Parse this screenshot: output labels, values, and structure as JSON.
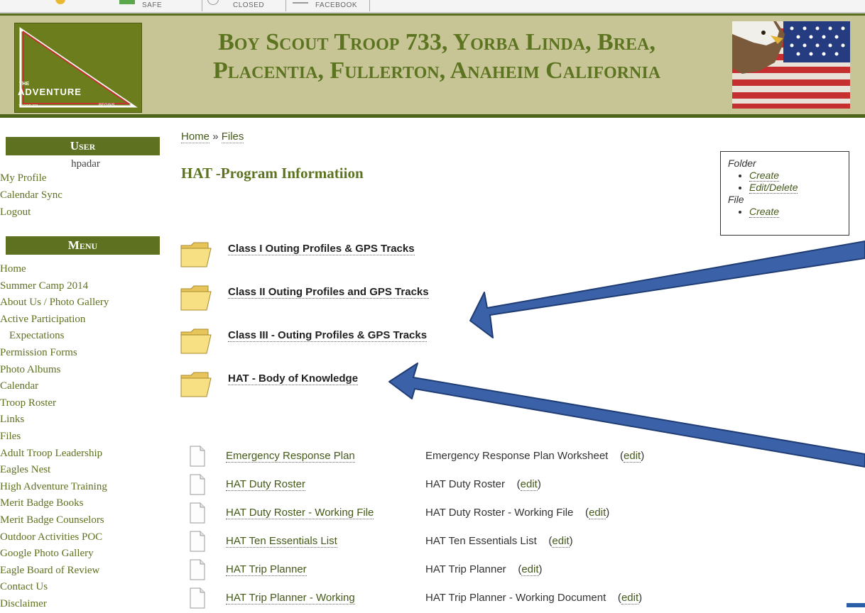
{
  "topbar": {
    "item_safe": "SAFE",
    "item_closed": "CLOSED",
    "item_facebook": "FACEBOOK"
  },
  "header": {
    "title": "Boy Scout Troop 733, Yorba Linda, Brea, Placentia, Fullerton, Anaheim California",
    "logo_the": "THE",
    "logo_adventure": "ADVENTURE",
    "logo_begins": "BEGINS...",
    "logo_troop": "TROOP 733"
  },
  "sidebar": {
    "user_title": "User",
    "username": "hpadar",
    "user_links": [
      "My Profile",
      "Calendar Sync",
      "Logout"
    ],
    "menu_title": "Menu",
    "menu_items": [
      "Home",
      "Summer Camp 2014",
      "About Us / Photo Gallery",
      "Active Participation",
      "Expectations",
      "Permission Forms",
      "Photo Albums",
      "Calendar",
      "Troop Roster",
      "Links",
      "Files",
      "Adult Troop Leadership",
      "Eagles Nest",
      "High Adventure Training",
      "Merit Badge Books",
      "Merit Badge Counselors",
      "Outdoor Activities POC",
      "Google Photo Gallery",
      "Eagle Board of Review",
      "Contact Us",
      "Disclaimer"
    ]
  },
  "breadcrumb": {
    "home": "Home",
    "sep": "»",
    "files": "Files"
  },
  "page_title": "HAT -Program Informatiion",
  "admin_box": {
    "folder_label": "Folder",
    "folder_create": "Create",
    "folder_edit": "Edit/Delete",
    "file_label": "File",
    "file_create": "Create"
  },
  "folders": [
    "Class I Outing Profiles & GPS Tracks",
    "Class II Outing Profiles and GPS Tracks",
    "Class III - Outing Profiles & GPS Tracks",
    "HAT - Body of Knowledge"
  ],
  "files": [
    {
      "name": "Emergency Response Plan",
      "desc": "Emergency Response Plan Worksheet",
      "edit": "edit"
    },
    {
      "name": "HAT Duty Roster",
      "desc": "HAT Duty Roster",
      "edit": "edit"
    },
    {
      "name": "HAT Duty Roster - Working File",
      "desc": "HAT Duty Roster - Working File",
      "edit": "edit"
    },
    {
      "name": "HAT Ten Essentials List",
      "desc": "HAT Ten Essentials List",
      "edit": "edit"
    },
    {
      "name": "HAT Trip Planner",
      "desc": "HAT Trip Planner",
      "edit": "edit"
    },
    {
      "name": "HAT Trip Planner - Working",
      "desc": "HAT Trip Planner - Working Document",
      "edit": "edit"
    }
  ],
  "colors": {
    "header_bg": "#c7c596",
    "accent_green": "#5d7120",
    "arrow_blue": "#3b62a8"
  }
}
